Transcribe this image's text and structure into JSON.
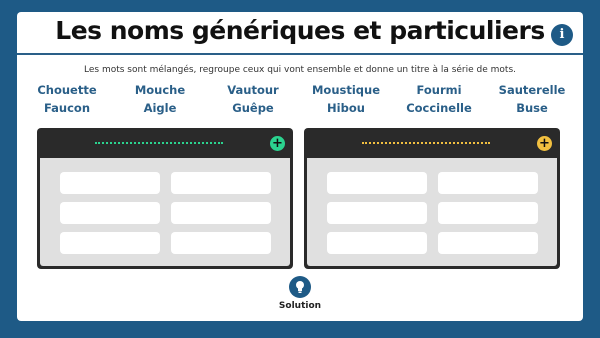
{
  "title": "Les noms génériques et particuliers",
  "info_button_label": "i",
  "instruction": "Les mots sont mélangés, regroupe ceux qui vont ensemble et donne un titre à la série de mots.",
  "words_row1": [
    "Chouette",
    "Mouche",
    "Vautour",
    "Moustique",
    "Fourmi",
    "Sauterelle"
  ],
  "words_row2": [
    "Faucon",
    "Aigle",
    "Guêpe",
    "Hibou",
    "Coccinelle",
    "Buse"
  ],
  "panels": [
    {
      "accent": "#2bd38f",
      "add_label": "+"
    },
    {
      "accent": "#f2c040",
      "add_label": "+"
    }
  ],
  "solution_label": "Solution",
  "icons": {
    "info": "info-icon",
    "solution": "lightbulb-icon",
    "add": "plus-icon"
  }
}
